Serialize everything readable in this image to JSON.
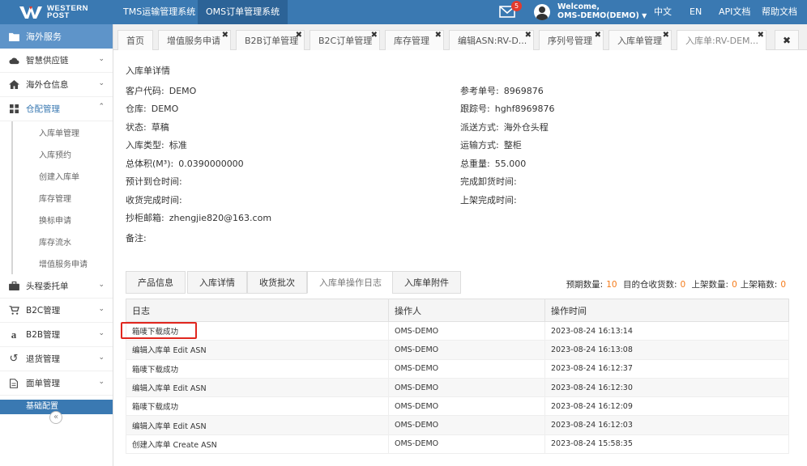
{
  "brand": {
    "name_line1": "WESTERN",
    "name_line2": "POST"
  },
  "system_tabs": [
    "TMS运输管理系统",
    "OMS订单管理系统"
  ],
  "header": {
    "mail_count": "5",
    "welcome_line1": "Welcome,",
    "welcome_line2": "OMS-DEMO(DEMO)",
    "links": [
      "中文",
      "EN",
      "API文档",
      "帮助文档"
    ]
  },
  "sidebar": {
    "head": "海外服务",
    "items": [
      {
        "label": "智慧供应链",
        "icon": "cloud-icon"
      },
      {
        "label": "海外仓信息",
        "icon": "home-icon"
      },
      {
        "label": "仓配管理",
        "icon": "grid-icon"
      }
    ],
    "subitems": [
      "入库单管理",
      "入库预约",
      "创建入库单",
      "库存管理",
      "换标申请",
      "库存流水",
      "增值服务申请"
    ],
    "items2": [
      {
        "label": "头程委托单",
        "icon": "briefcase-icon"
      },
      {
        "label": "B2C管理",
        "icon": "cart-icon"
      },
      {
        "label": "B2B管理",
        "icon": "amazon-icon"
      },
      {
        "label": "退货管理",
        "icon": "return-icon"
      },
      {
        "label": "面单管理",
        "icon": "document-icon"
      }
    ],
    "bottom": "基础配置"
  },
  "tabs": [
    "首页",
    "增值服务申请",
    "B2B订单管理",
    "B2C订单管理",
    "库存管理",
    "编辑ASN:RV-D...",
    "序列号管理",
    "入库单管理",
    "入库单:RV-DEM..."
  ],
  "detail": {
    "title": "入库单详情",
    "left": [
      {
        "k": "客户代码:",
        "v": "DEMO"
      },
      {
        "k": "仓库:",
        "v": "DEMO"
      },
      {
        "k": "状态:",
        "v": "草稿"
      },
      {
        "k": "入库类型:",
        "v": "标准"
      },
      {
        "k": "总体积(M³):",
        "v": "0.0390000000"
      },
      {
        "k": "预计到仓时间:",
        "v": ""
      },
      {
        "k": "收货完成时间:",
        "v": ""
      },
      {
        "k": "抄柜邮箱:",
        "v": "zhengjie820@163.com"
      },
      {
        "k": "备注:",
        "v": ""
      }
    ],
    "right": [
      {
        "k": "参考单号:",
        "v": "8969876"
      },
      {
        "k": "跟踪号:",
        "v": "hghf8969876"
      },
      {
        "k": "派送方式:",
        "v": "海外仓头程"
      },
      {
        "k": "运输方式:",
        "v": "整柜"
      },
      {
        "k": "总重量:",
        "v": "55.000"
      },
      {
        "k": "完成卸货时间:",
        "v": ""
      },
      {
        "k": "上架完成时间:",
        "v": ""
      }
    ]
  },
  "inner_tabs": [
    "产品信息",
    "入库详情",
    "收货批次",
    "入库单操作日志",
    "入库单附件"
  ],
  "summary": {
    "expected_label": "预期数量:",
    "expected": "10",
    "received_label": "目的仓收货数:",
    "received": "0",
    "shelved_label": "上架数量:",
    "shelved": "0",
    "boxes_label": "上架箱数:",
    "boxes": "0"
  },
  "log_table": {
    "headers": [
      "日志",
      "操作人",
      "操作时间"
    ],
    "rows": [
      [
        "箱唛下载成功",
        "OMS-DEMO",
        "2023-08-24 16:13:14"
      ],
      [
        "编辑入库单 Edit ASN",
        "OMS-DEMO",
        "2023-08-24 16:13:08"
      ],
      [
        "箱唛下载成功",
        "OMS-DEMO",
        "2023-08-24 16:12:37"
      ],
      [
        "编辑入库单 Edit ASN",
        "OMS-DEMO",
        "2023-08-24 16:12:30"
      ],
      [
        "箱唛下载成功",
        "OMS-DEMO",
        "2023-08-24 16:12:09"
      ],
      [
        "编辑入库单 Edit ASN",
        "OMS-DEMO",
        "2023-08-24 16:12:03"
      ],
      [
        "创建入库单 Create ASN",
        "OMS-DEMO",
        "2023-08-24 15:58:35"
      ]
    ]
  },
  "colors": {
    "primary": "#3a79b2",
    "accent": "#f57b1a",
    "highlight": "#e0261e"
  }
}
